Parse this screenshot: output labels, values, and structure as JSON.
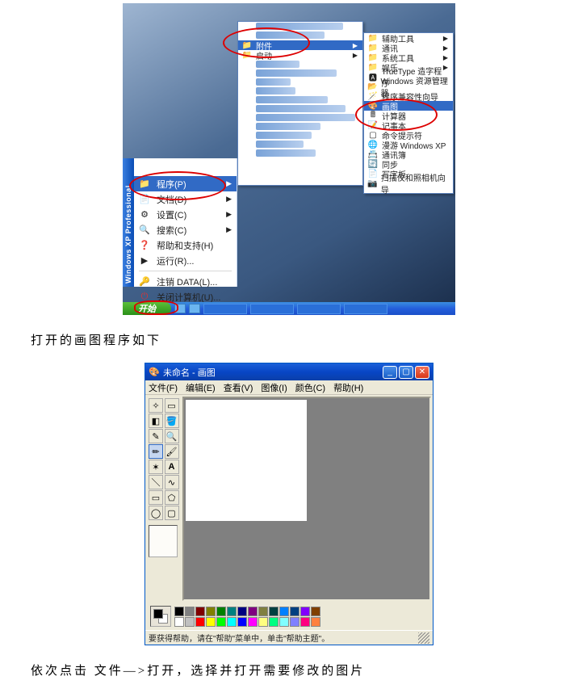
{
  "xp_label": "Windows XP Professional",
  "start_menu": {
    "programs": {
      "label": "程序(P)",
      "underline": "P"
    },
    "documents": "文档(D)",
    "settings": "设置(C)",
    "search": "搜索(C)",
    "help": "帮助和支持(H)",
    "run": "运行(R)...",
    "logoff": "注销 DATA(L)...",
    "shutdown": "关闭计算机(U)..."
  },
  "sub_accessories": "附件",
  "sub_startup": "启动",
  "acc_items": {
    "i0": "辅助工具",
    "i1": "通讯",
    "i2": "系统工具",
    "i3": "娱乐",
    "i4": "TrueType 造字程序",
    "i5": "Windows 资源管理器",
    "i6": "程序兼容性向导",
    "i7": "画图",
    "i8": "计算器",
    "i9": "记事本",
    "i10": "命令提示符",
    "i11": "漫游 Windows XP",
    "i12": "通讯簿",
    "i13": "同步",
    "i14": "写字板",
    "i15": "扫描仪和照相机向导"
  },
  "start_button": "开始",
  "caption1": "打开的画图程序如下",
  "paint": {
    "title": "未命名 - 画图",
    "menu": {
      "file": "文件(F)",
      "edit": "编辑(E)",
      "view": "查看(V)",
      "image": "图像(I)",
      "color": "颜色(C)",
      "help": "帮助(H)"
    },
    "status": "要获得帮助，请在\"帮助\"菜单中，单击\"帮助主题\"。"
  },
  "palette_row1": [
    "#000000",
    "#808080",
    "#800000",
    "#808000",
    "#008000",
    "#008080",
    "#000080",
    "#800080",
    "#808040",
    "#004040",
    "#0080ff",
    "#004080",
    "#8000ff",
    "#804000"
  ],
  "palette_row2": [
    "#ffffff",
    "#c0c0c0",
    "#ff0000",
    "#ffff00",
    "#00ff00",
    "#00ffff",
    "#0000ff",
    "#ff00ff",
    "#ffff80",
    "#00ff80",
    "#80ffff",
    "#8080ff",
    "#ff0080",
    "#ff8040"
  ],
  "caption2": "依次点击   文件—>打开，选择并打开需要修改的图片"
}
